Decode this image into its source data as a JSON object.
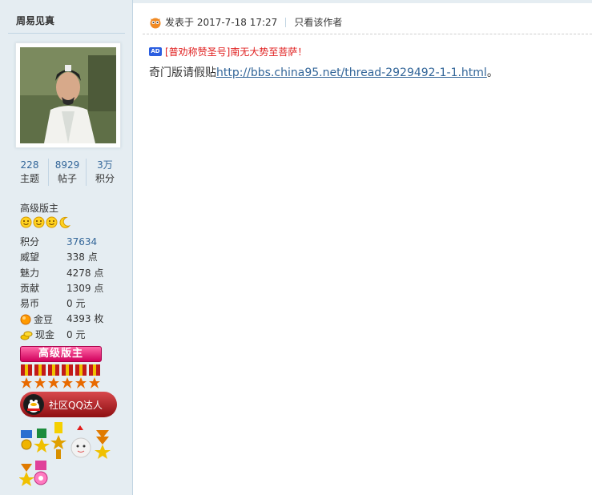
{
  "author": {
    "name": "周易见真"
  },
  "stats": [
    {
      "num": "228",
      "label": "主题"
    },
    {
      "num": "8929",
      "label": "帖子"
    },
    {
      "num": "3万",
      "label": "积分"
    }
  ],
  "rank": "高级版主",
  "info": [
    {
      "key": "积分",
      "value": "37634",
      "icon": ""
    },
    {
      "key": "威望",
      "value": "338 点",
      "icon": ""
    },
    {
      "key": "魅力",
      "value": "4278 点",
      "icon": ""
    },
    {
      "key": "贡献",
      "value": "1309 点",
      "icon": ""
    },
    {
      "key": "易币",
      "value": "0 元",
      "icon": ""
    },
    {
      "key": "金豆",
      "value": "4393 枚",
      "icon": "gold-bean-icon"
    },
    {
      "key": "现金",
      "value": "0 元",
      "icon": "cash-coins-icon"
    }
  ],
  "rank_badge": "高级版主",
  "qq_badge": "社区QQ达人",
  "post": {
    "posted_at": "发表于 2017-7-18 17:27",
    "only_author": "只看该作者",
    "ad_tag": "AD",
    "ad_text": "[普劝称赞圣号]南无大势至菩萨！",
    "body_prefix": "奇门版请假贴",
    "link": "http://bbs.china95.net/thread-2929492-1-1.html",
    "body_suffix": "。"
  },
  "colors": {
    "sidebar": "#e5edf2",
    "link": "#336699",
    "ad": "#e02020",
    "badge": "#d1005c"
  }
}
